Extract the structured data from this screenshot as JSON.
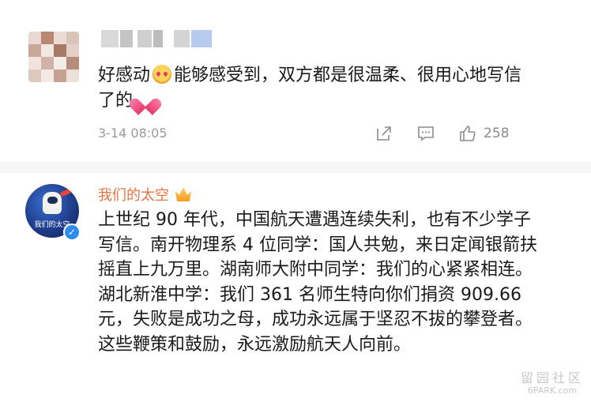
{
  "comment1": {
    "text_before_emoji": "好感动",
    "text_after_emoji": "能够感受到，双方都是很温柔、很用心地写信了的",
    "emoji_1": "blush-face-icon",
    "emoji_2": "heart-icon",
    "timestamp": "3-14 08:05",
    "actions": {
      "share_icon": "share-icon",
      "comment_icon": "comment-icon",
      "like_icon": "thumbs-up-icon",
      "like_count": "258"
    }
  },
  "comment2": {
    "username": "我们的太空",
    "username_color": "#eb7340",
    "avatar_text": "我们的太空",
    "verified_icon": "verified-badge-icon",
    "body": "上世纪 90 年代，中国航天遭遇连续失利，也有不少学子写信。南开物理系 4 位同学：国人共勉，来日定闻银箭扶摇直上九万里。湖南师大附中同学：我们的心紧紧相连。湖北新淮中学：我们 361 名师生特向你们捐资 909.66 元，失败是成功之母，成功永远属于坚忍不拔的攀登者。这些鞭策和鼓励，永远激励航天人向前。"
  },
  "watermark": {
    "line1": "留园社区",
    "line2": "6PARK.com"
  }
}
